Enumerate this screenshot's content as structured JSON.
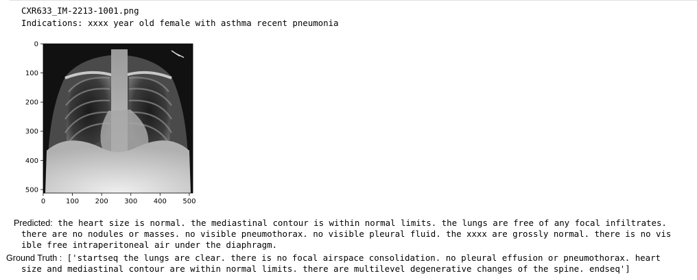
{
  "output": {
    "filename": "CXR633_IM-2213-1001.png",
    "indications": "Indications: xxxx year old female with asthma recent pneumonia"
  },
  "figure": {
    "image_alt_icon": "chest-xray-image",
    "y_ticks": [
      "0",
      "100",
      "200",
      "300",
      "400",
      "500"
    ],
    "x_ticks": [
      "0",
      "100",
      "200",
      "300",
      "400",
      "500"
    ],
    "xlim": [
      0,
      512
    ],
    "ylim": [
      512,
      0
    ]
  },
  "report": {
    "predicted_label": "Predicted:",
    "predicted_line1": " the heart size is normal. the mediastinal contour is within normal limits. the lungs are free of any focal infiltrates.",
    "predicted_line2": "there are no nodules or masses. no visible pneumothorax. no visible pleural fluid. the xxxx are grossly normal. there is no vis",
    "predicted_line3": "ible free intraperitoneal air under the diaphragm.",
    "ground_truth_label": "Ground Truth :",
    "ground_truth_line1": " ['startseq the lungs are clear. there is no focal airspace consolidation. no pleural effusion or pneumothorax. heart",
    "ground_truth_line2": "size and mediastinal contour are within normal limits. there are multilevel degenerative changes of the spine. endseq']"
  }
}
